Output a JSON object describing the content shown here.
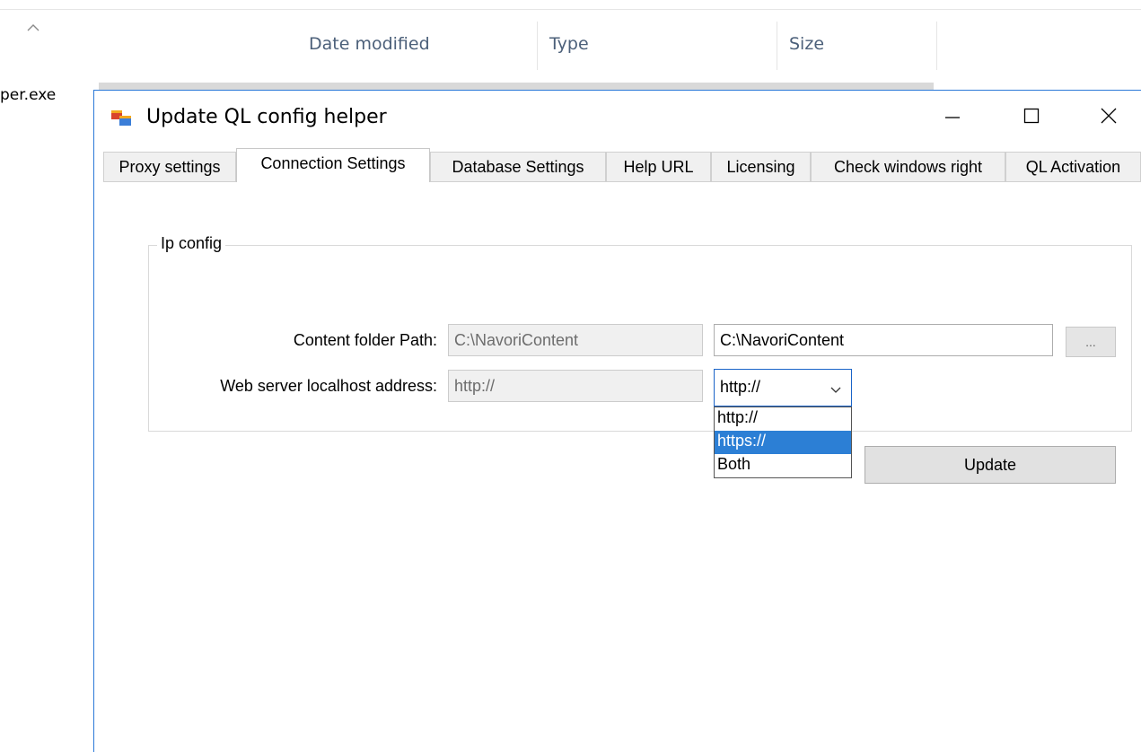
{
  "explorer": {
    "columns": [
      {
        "label": "Date modified"
      },
      {
        "label": "Type"
      },
      {
        "label": "Size"
      }
    ],
    "file_name_partial": "per.exe"
  },
  "window": {
    "title": "Update QL config helper",
    "icon": "app-window-icon",
    "controls": {
      "minimize": "minimize-icon",
      "maximize": "maximize-icon",
      "close": "close-icon"
    }
  },
  "tabs": [
    {
      "label": "Proxy settings",
      "active": false
    },
    {
      "label": "Connection Settings",
      "active": true
    },
    {
      "label": "Database Settings",
      "active": false
    },
    {
      "label": "Help URL",
      "active": false
    },
    {
      "label": "Licensing",
      "active": false
    },
    {
      "label": "Check windows right",
      "active": false
    },
    {
      "label": "QL Activation",
      "active": false
    }
  ],
  "ip_config": {
    "group_title": "Ip config",
    "content_folder": {
      "label": "Content folder Path:",
      "current_value": "C:\\NavoriContent",
      "new_value": "C:\\NavoriContent",
      "browse_label": "..."
    },
    "web_server": {
      "label": "Web server localhost address:",
      "current_value": "http://",
      "selected_protocol": "http://",
      "options": [
        "http://",
        "https://",
        "Both"
      ],
      "highlighted_option": "https://"
    }
  },
  "actions": {
    "update_label": "Update"
  },
  "colors": {
    "accent": "#2c7fd5",
    "window_border": "#2b79d8",
    "header_text": "#4c607a"
  }
}
